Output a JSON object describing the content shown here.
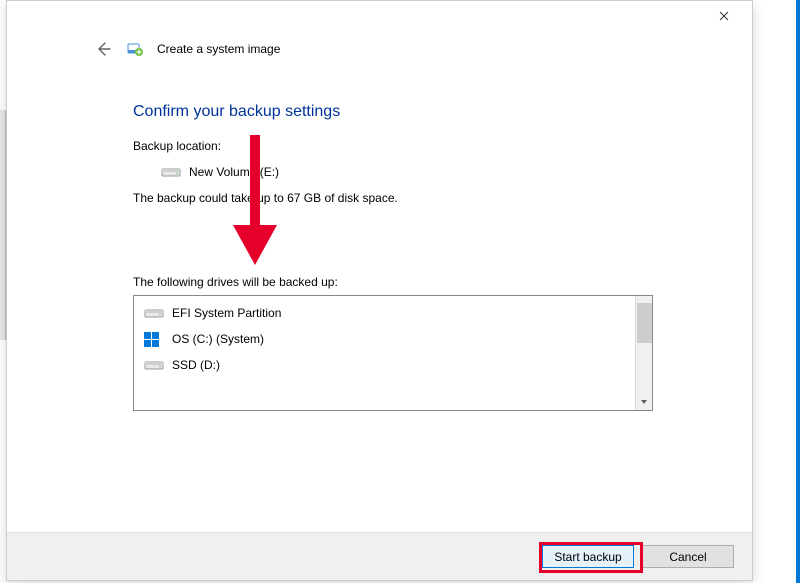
{
  "header": {
    "wizard_title": "Create a system image"
  },
  "content": {
    "heading": "Confirm your backup settings",
    "backup_location_label": "Backup location:",
    "backup_location_value": "New Volume (E:)",
    "size_estimate": "The backup could take up to 67 GB of disk space.",
    "drives_label": "The following drives will be backed up:",
    "drives": [
      {
        "name": "EFI System Partition",
        "icon": "drive"
      },
      {
        "name": "OS (C:) (System)",
        "icon": "windows"
      },
      {
        "name": "SSD (D:)",
        "icon": "drive"
      }
    ]
  },
  "footer": {
    "start_label": "Start backup",
    "cancel_label": "Cancel"
  }
}
